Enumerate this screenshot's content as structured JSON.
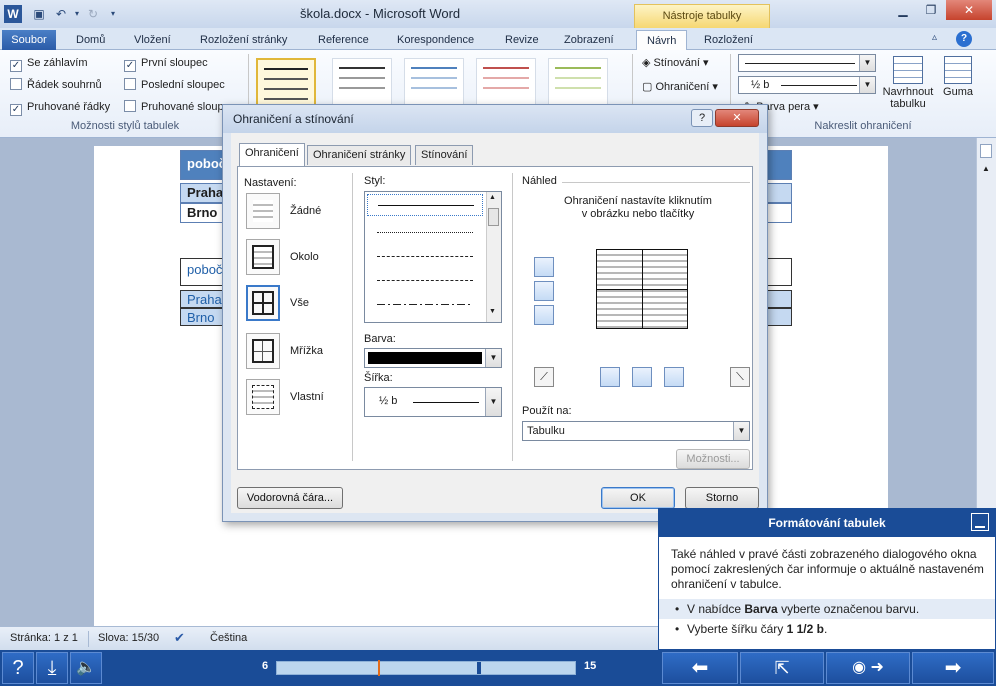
{
  "window": {
    "title": "škola.docx - Microsoft Word",
    "context_tab_title": "Nástroje tabulky"
  },
  "ribbon_tabs": [
    "Soubor",
    "Domů",
    "Vložení",
    "Rozložení stránky",
    "Reference",
    "Korespondence",
    "Revize",
    "Zobrazení",
    "Návrh",
    "Rozložení"
  ],
  "ribbon": {
    "style_options": {
      "items": [
        {
          "label": "Se záhlavím",
          "checked": true
        },
        {
          "label": "Řádek souhrnů",
          "checked": false
        },
        {
          "label": "Pruhované řádky",
          "checked": true
        },
        {
          "label": "První sloupec",
          "checked": true
        },
        {
          "label": "Poslední sloupec",
          "checked": false
        },
        {
          "label": "Pruhované sloup",
          "checked": false
        }
      ],
      "group_label": "Možnosti stylů tabulek"
    },
    "shading_label": "Stínování",
    "borders_label": "Ohraničení",
    "pen_weight": "½ b",
    "pen_color_label": "Barva pera",
    "draw_table_label": "Navrhnout tabulku",
    "eraser_label": "Guma",
    "draw_group_label": "Nakreslit ohraničení"
  },
  "document": {
    "table1": [
      "poboč",
      "Praha",
      "Brno"
    ],
    "table2": [
      "poboč",
      "Praha",
      "Brno"
    ]
  },
  "dialog": {
    "title": "Ohraničení a stínování",
    "tabs": [
      "Ohraničení",
      "Ohraničení stránky",
      "Stínování"
    ],
    "settings_label": "Nastavení:",
    "settings": [
      "Žádné",
      "Okolo",
      "Vše",
      "Mřížka",
      "Vlastní"
    ],
    "style_label": "Styl:",
    "color_label": "Barva:",
    "width_label": "Šířka:",
    "width_value": "½ b",
    "preview_label": "Náhled",
    "preview_hint_line1": "Ohraničení nastavíte kliknutím",
    "preview_hint_line2": "v obrázku nebo tlačítky",
    "apply_to_label": "Použít na:",
    "apply_to_value": "Tabulku",
    "options_button": "Možnosti...",
    "horizontal_line_button": "Vodorovná čára...",
    "ok_button": "OK",
    "cancel_button": "Storno"
  },
  "statusbar": {
    "page": "Stránka: 1 z 1",
    "words": "Slova: 15/30",
    "language": "Čeština"
  },
  "help_panel": {
    "title": "Formátování tabulek",
    "text": "Také náhled v pravé části zobrazeného dialogového okna pomocí zakreslených čar informuje o aktuálně nastaveném ohraničení v tabulce.",
    "step1_pre": "V nabídce ",
    "step1_bold": "Barva",
    "step1_post": " vyberte označenou barvu.",
    "step2_pre": "Vyberte šířku čáry ",
    "step2_bold": "1 1/2 b",
    "step2_post": "."
  },
  "navigation": {
    "progress_start": "6",
    "progress_end": "15",
    "progress_value": 0.34
  },
  "colors": {
    "accent": "#1a4c97",
    "ribbon_file": "#2b5ba8",
    "selection": "#c5d9f1"
  }
}
